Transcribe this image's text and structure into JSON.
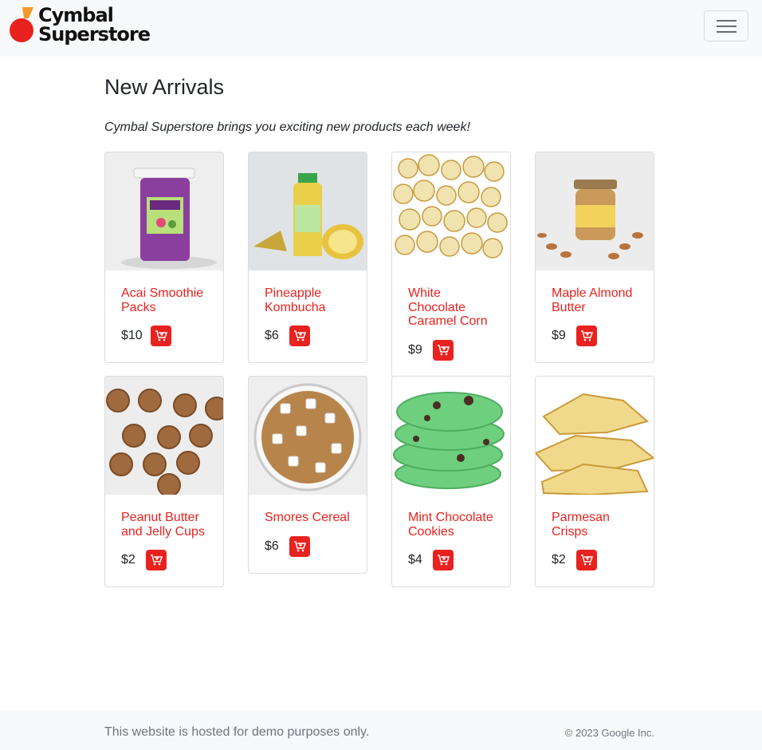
{
  "header": {
    "brand_line1": "Cymbal",
    "brand_line2": "Superstore",
    "menu_icon": "hamburger-icon"
  },
  "page": {
    "title": "New Arrivals",
    "subtitle": "Cymbal Superstore brings you exciting new products each week!"
  },
  "colors": {
    "accent": "#e8221e",
    "logo_orange": "#f39a2b",
    "navbar_bg": "#f8f9fa"
  },
  "products": [
    {
      "name": "Acai Smoothie Packs",
      "price": "$10",
      "image": "acai-jar"
    },
    {
      "name": "Pineapple Kombucha",
      "price": "$6",
      "image": "kombucha-bottle"
    },
    {
      "name": "White Chocolate Caramel Corn",
      "price": "$9",
      "image": "popcorn"
    },
    {
      "name": "Maple Almond Butter",
      "price": "$9",
      "image": "almond-butter-jar"
    },
    {
      "name": "Peanut Butter and Jelly Cups",
      "price": "$2",
      "image": "pb-cups"
    },
    {
      "name": "Smores Cereal",
      "price": "$6",
      "image": "cereal-bowl"
    },
    {
      "name": "Mint Chocolate Cookies",
      "price": "$4",
      "image": "mint-cookies"
    },
    {
      "name": "Parmesan Crisps",
      "price": "$2",
      "image": "parmesan-crisps"
    }
  ],
  "footer": {
    "note": "This website is hosted for demo purposes only.",
    "copyright": "© 2023 Google Inc."
  }
}
